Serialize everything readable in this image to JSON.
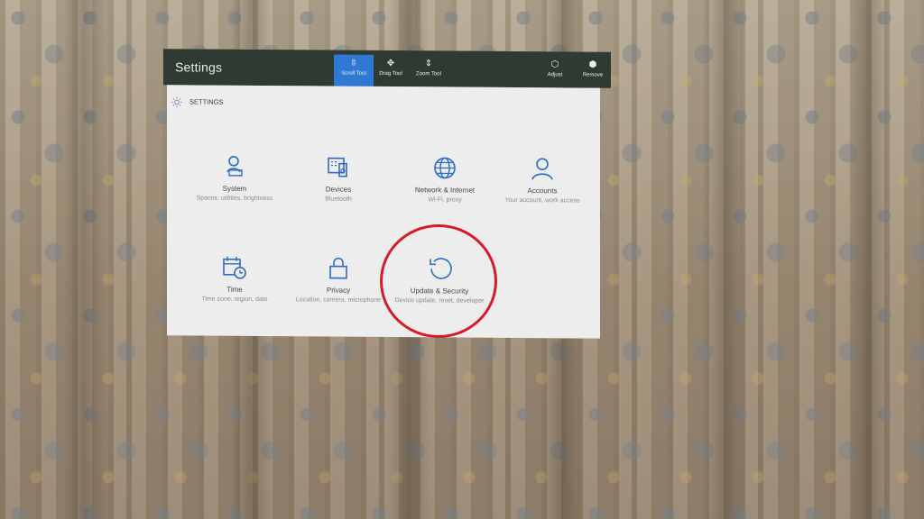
{
  "window": {
    "title": "Settings",
    "tools": {
      "scroll": "Scroll Tool",
      "drag": "Drag Tool",
      "zoom": "Zoom Tool"
    },
    "actions": {
      "adjust": "Adjust",
      "remove": "Remove"
    }
  },
  "settings": {
    "header": "SETTINGS",
    "tiles": [
      {
        "icon": "laptop-person-icon",
        "name": "System",
        "desc": "Spaces, utilities, brightness"
      },
      {
        "icon": "devices-icon",
        "name": "Devices",
        "desc": "Bluetooth"
      },
      {
        "icon": "globe-icon",
        "name": "Network & Internet",
        "desc": "Wi-Fi, proxy"
      },
      {
        "icon": "person-icon",
        "name": "Accounts",
        "desc": "Your account, work access"
      },
      {
        "icon": "calendar-clock-icon",
        "name": "Time",
        "desc": "Time zone, region, date"
      },
      {
        "icon": "lock-icon",
        "name": "Privacy",
        "desc": "Location, camera, microphone"
      },
      {
        "icon": "refresh-icon",
        "name": "Update & Security",
        "desc": "Device update, reset, developer"
      }
    ]
  },
  "colors": {
    "accent": "#2f78d4",
    "titlebar": "#2f3a33",
    "panel": "#ededed",
    "highlight": "#d8192a",
    "icon": "#2e6bc4"
  }
}
